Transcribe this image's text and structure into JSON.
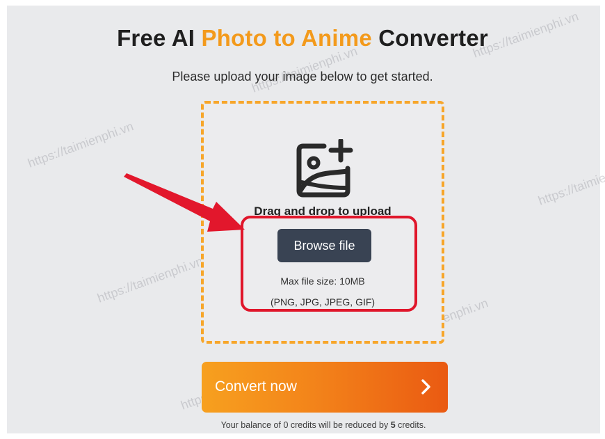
{
  "title": {
    "prefix": "Free AI ",
    "accent": "Photo to Anime",
    "suffix": " Converter"
  },
  "subtitle": "Please upload your image below to get started.",
  "upload": {
    "icon": "image-plus-icon",
    "drag_text": "Drag and drop to upload",
    "browse_label": "Browse file",
    "max_size": "Max file size: 10MB",
    "formats": "(PNG, JPG, JPEG, GIF)"
  },
  "convert": {
    "label": "Convert now",
    "icon": "chevron-right-icon"
  },
  "balance": {
    "before": "Your balance of 0 credits will be reduced by ",
    "amount": "5",
    "after": " credits."
  },
  "watermark": "https://taimienphi.vn",
  "colors": {
    "accent": "#f39a1c",
    "dashed_border": "#f7a62a",
    "browse_button": "#394353",
    "highlight": "#e0162b",
    "convert_start": "#f7a01f",
    "convert_end": "#ea5a12"
  }
}
